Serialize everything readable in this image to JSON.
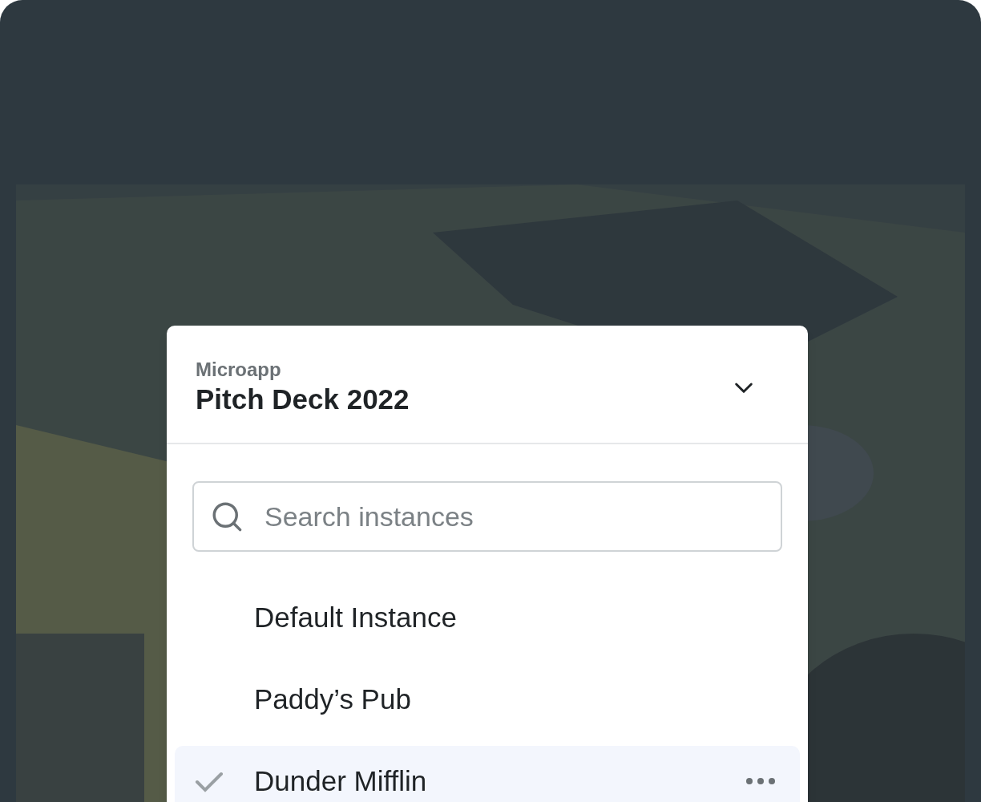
{
  "popup": {
    "label": "Microapp",
    "title": "Pitch Deck 2022",
    "expanded": true,
    "search": {
      "placeholder": "Search instances"
    },
    "instances": [
      {
        "name": "Default Instance",
        "selected": false
      },
      {
        "name": "Paddy’s Pub",
        "selected": false
      },
      {
        "name": "Dunder Mifflin",
        "selected": true
      }
    ]
  }
}
